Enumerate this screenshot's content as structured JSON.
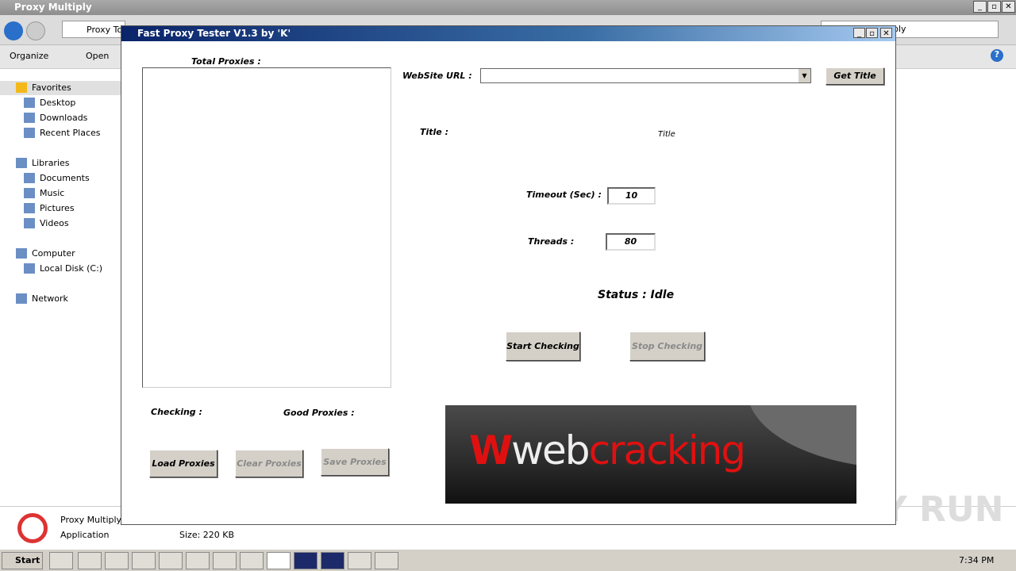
{
  "explorer": {
    "title": "Proxy Multiply",
    "address": "Proxy To",
    "search": "ply",
    "organize": "Organize",
    "open": "Open",
    "sidebar": [
      {
        "label": "Favorites",
        "top": true
      },
      {
        "label": "Desktop"
      },
      {
        "label": "Downloads"
      },
      {
        "label": "Recent Places"
      },
      {
        "label": "Libraries",
        "top": true
      },
      {
        "label": "Documents"
      },
      {
        "label": "Music"
      },
      {
        "label": "Pictures"
      },
      {
        "label": "Videos"
      },
      {
        "label": "Computer",
        "top": true
      },
      {
        "label": "Local Disk (C:)"
      },
      {
        "label": "Network",
        "top": true
      }
    ],
    "details": {
      "name": "Proxy Multiply",
      "type": "Application",
      "size": "Size: 220 KB"
    }
  },
  "app": {
    "title": "Fast Proxy Tester V1.3 by 'K'",
    "total_proxies_label": "Total Proxies :",
    "website_url_label": "WebSite URL :",
    "website_url_value": "",
    "get_title": "Get Title",
    "title_label": "Title :",
    "title_value": "Title",
    "timeout_label": "Timeout (Sec) :",
    "timeout_value": "10",
    "threads_label": "Threads :",
    "threads_value": "80",
    "status": "Status : Idle",
    "start": "Start Checking",
    "stop": "Stop Checking",
    "checking_label": "Checking :",
    "good_label": "Good Proxies :",
    "load": "Load Proxies",
    "clear": "Clear Proxies",
    "save": "Save Proxies",
    "banner_logo": "webcracking"
  },
  "taskbar": {
    "start": "Start",
    "clock": "7:34 PM"
  },
  "watermark": "ANY RUN"
}
